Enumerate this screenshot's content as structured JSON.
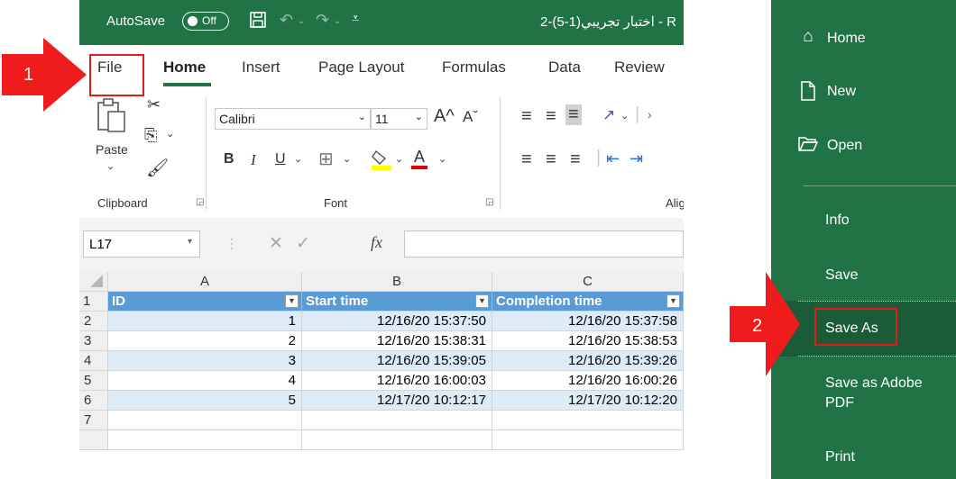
{
  "titlebar": {
    "autosave_label": "AutoSave",
    "autosave_state": "Off",
    "doc_title": "2-(5-1)اختبار تجريبي  -  R"
  },
  "tabs": [
    {
      "label": "File"
    },
    {
      "label": "Home"
    },
    {
      "label": "Insert"
    },
    {
      "label": "Page Layout"
    },
    {
      "label": "Formulas"
    },
    {
      "label": "Data"
    },
    {
      "label": "Review"
    }
  ],
  "ribbon": {
    "paste_label": "Paste",
    "clipboard_label": "Clipboard",
    "font_name": "Calibri",
    "font_size": "11",
    "font_label": "Font",
    "alignment_label": "Alig",
    "bold": "B",
    "italic": "I",
    "underline": "U",
    "grow_font": "A^",
    "shrink_font": "Aˇ",
    "font_color": "A"
  },
  "formula_bar": {
    "name_box": "L17",
    "fx": "fx",
    "formula": ""
  },
  "sheet": {
    "column_headers": [
      "A",
      "B",
      "C"
    ],
    "table_headers": [
      "ID",
      "Start time",
      "Completion time"
    ],
    "rows": [
      {
        "num": "2",
        "id": "1",
        "start": "12/16/20 15:37:50",
        "end": "12/16/20 15:37:58"
      },
      {
        "num": "3",
        "id": "2",
        "start": "12/16/20 15:38:31",
        "end": "12/16/20 15:38:53"
      },
      {
        "num": "4",
        "id": "3",
        "start": "12/16/20 15:39:05",
        "end": "12/16/20 15:39:26"
      },
      {
        "num": "5",
        "id": "4",
        "start": "12/16/20 16:00:03",
        "end": "12/16/20 16:00:26"
      },
      {
        "num": "6",
        "id": "5",
        "start": "12/17/20 10:12:17",
        "end": "12/17/20 10:12:20"
      }
    ],
    "header_row_num": "1",
    "empty_row_num": "7"
  },
  "backstage": {
    "home": "Home",
    "new": "New",
    "open": "Open",
    "info": "Info",
    "save": "Save",
    "save_as": "Save As",
    "save_as_pdf_line1": "Save as Adobe",
    "save_as_pdf_line2": "PDF",
    "print": "Print"
  },
  "annotations": {
    "step1": "1",
    "step2": "2"
  },
  "colors": {
    "excel_green": "#217346",
    "table_header_blue": "#5b9bd5",
    "band_blue": "#ddebf7",
    "annotation_red": "#e31b1b"
  }
}
